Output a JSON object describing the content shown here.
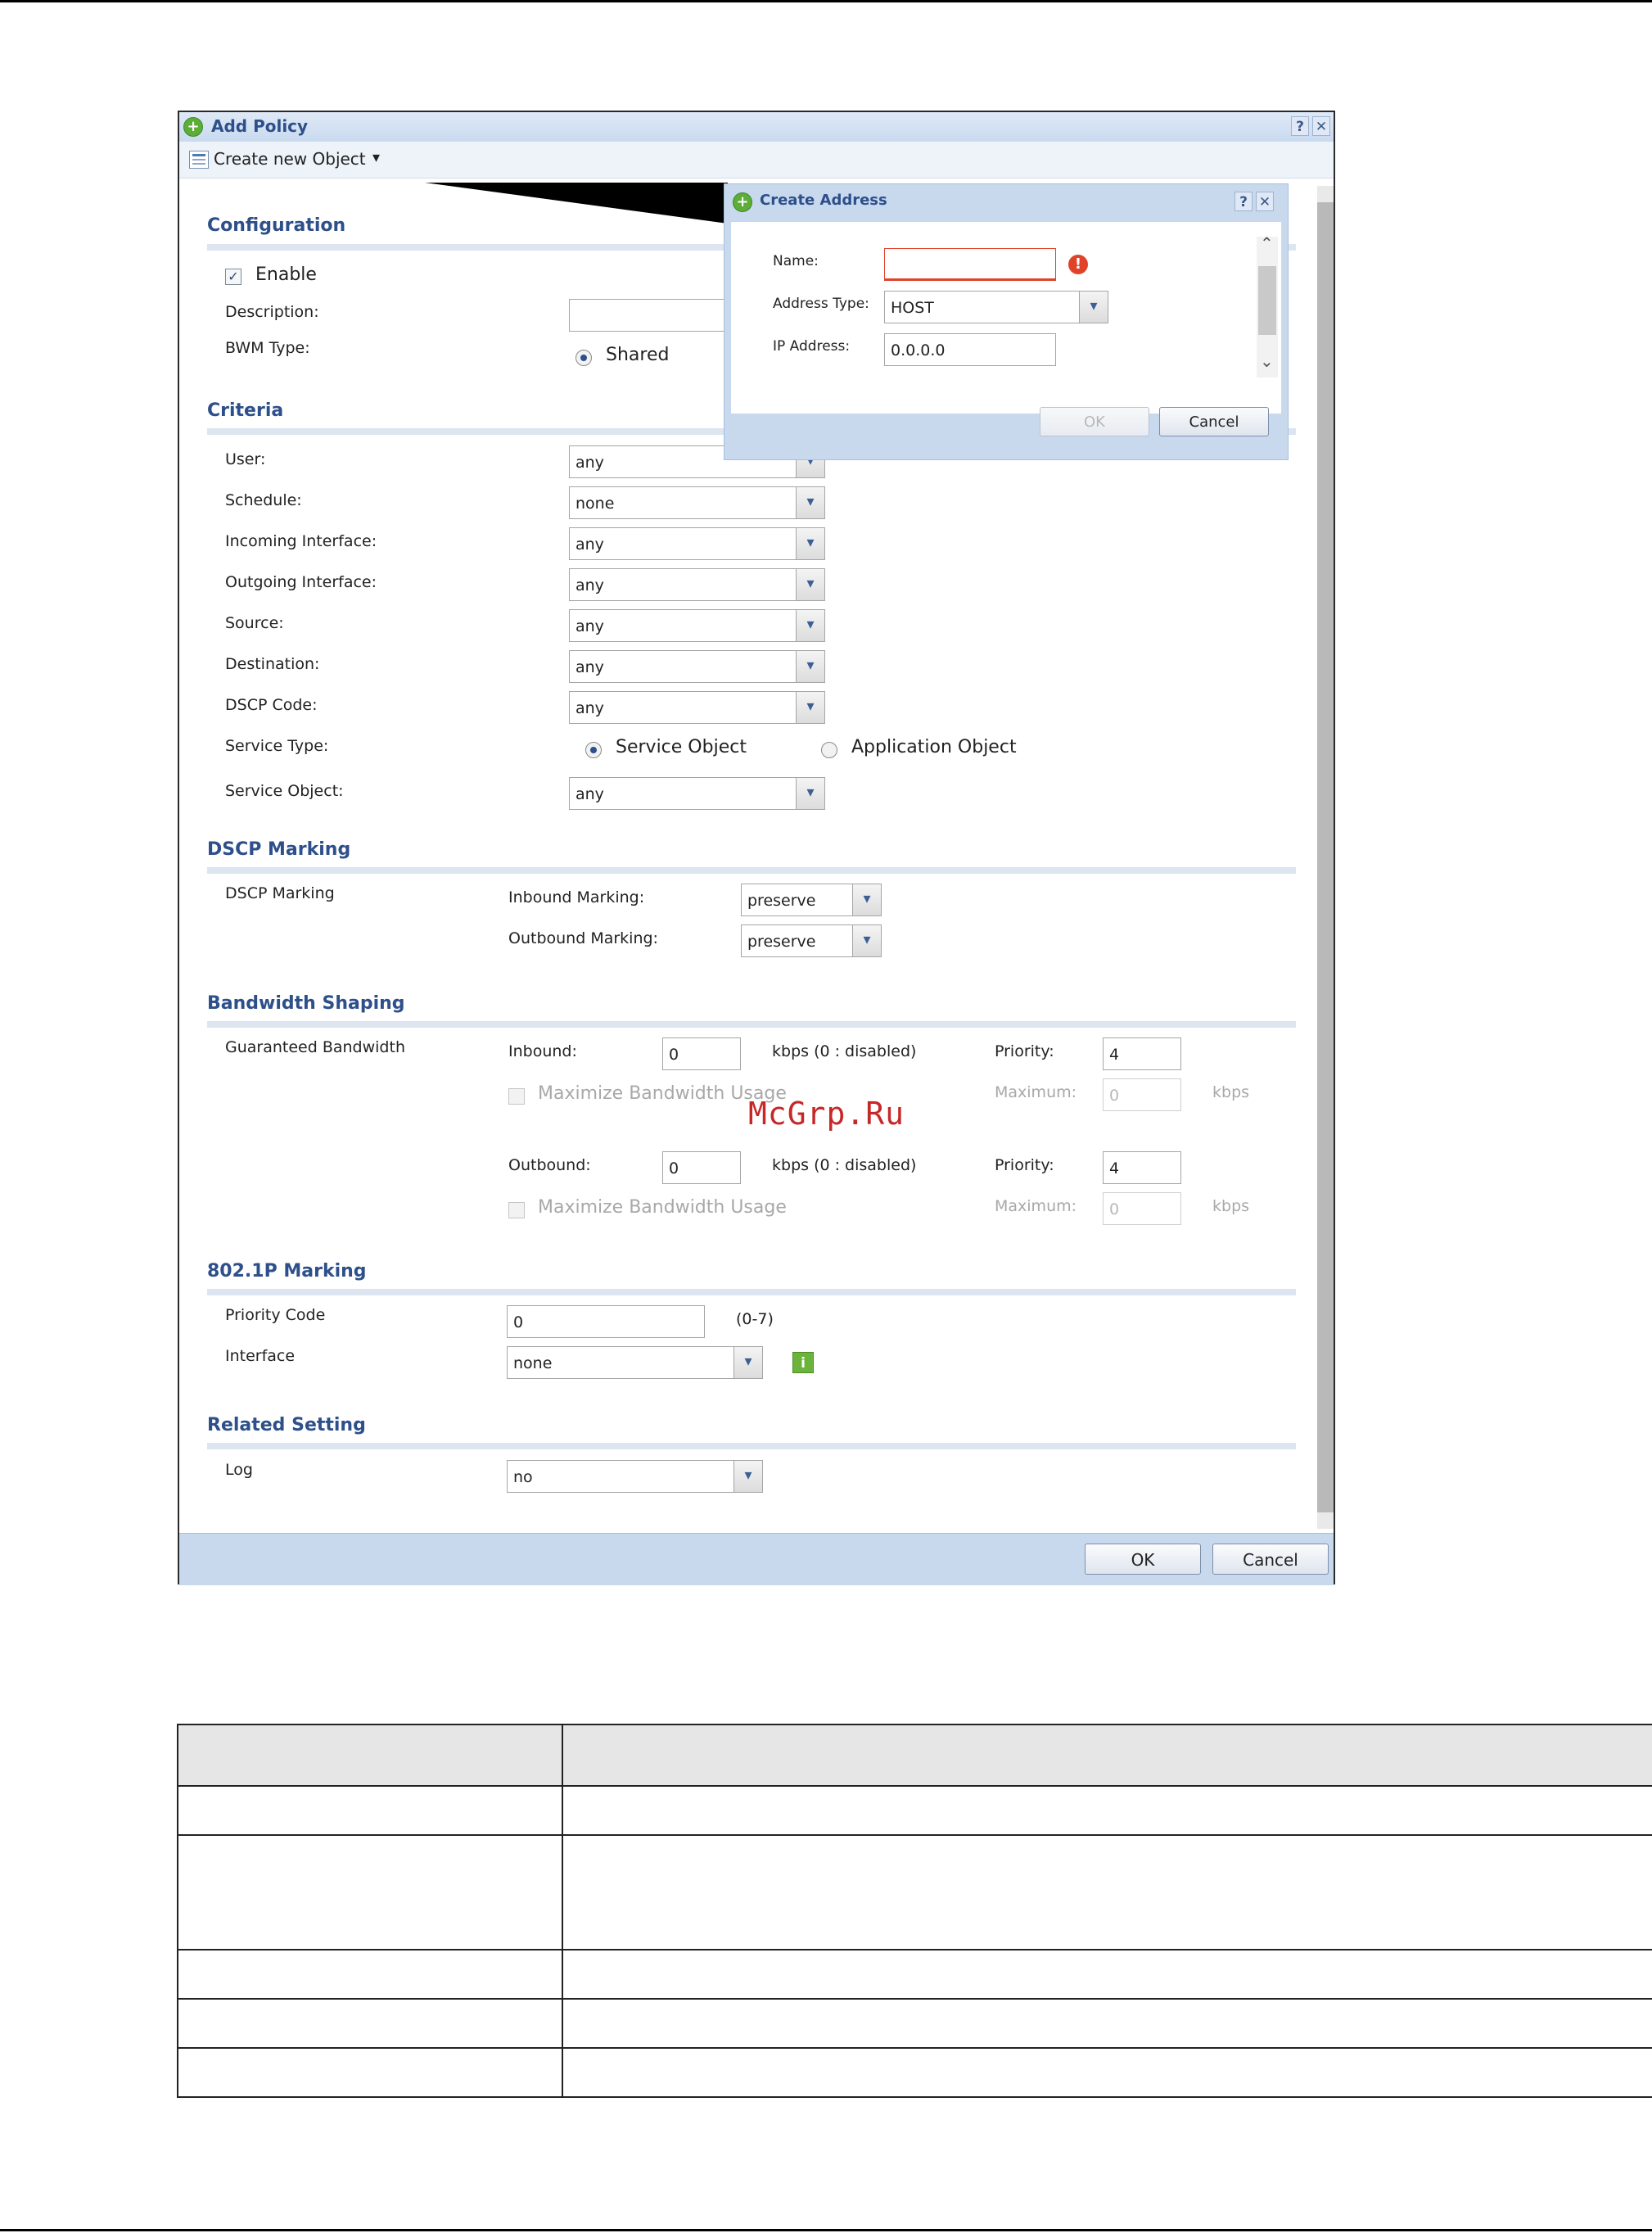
{
  "dialog": {
    "title": "Add Policy",
    "help": "?",
    "close": "✕",
    "toolbar_label": "Create new Object",
    "toolbar_arrow": "▾",
    "ok": "OK",
    "cancel": "Cancel"
  },
  "configuration": {
    "heading": "Configuration",
    "enable_label": "Enable",
    "enable_checked": true,
    "description_label": "Description:",
    "description_value": "",
    "bwm_label": "BWM Type:",
    "bwm_value": "Shared"
  },
  "criteria": {
    "heading": "Criteria",
    "rows": [
      {
        "label": "User:",
        "value": "any"
      },
      {
        "label": "Schedule:",
        "value": "none"
      },
      {
        "label": "Incoming Interface:",
        "value": "any"
      },
      {
        "label": "Outgoing Interface:",
        "value": "any"
      },
      {
        "label": "Source:",
        "value": "any"
      },
      {
        "label": "Destination:",
        "value": "any"
      },
      {
        "label": "DSCP Code:",
        "value": "any"
      }
    ],
    "service_type_label": "Service Type:",
    "service_type_options": [
      "Service Object",
      "Application Object"
    ],
    "service_type_selected": "Service Object",
    "service_object_label": "Service Object:",
    "service_object_value": "any"
  },
  "dscp": {
    "heading": "DSCP Marking",
    "row_label": "DSCP Marking",
    "inbound_label": "Inbound Marking:",
    "inbound_value": "preserve",
    "outbound_label": "Outbound Marking:",
    "outbound_value": "preserve"
  },
  "bandwidth": {
    "heading": "Bandwidth Shaping",
    "row_label": "Guaranteed Bandwidth",
    "inbound_label": "Inbound:",
    "inbound_value": "0",
    "outbound_label": "Outbound:",
    "outbound_value": "0",
    "unit_note": "kbps (0 : disabled)",
    "priority_label": "Priority:",
    "inbound_priority": "4",
    "outbound_priority": "4",
    "maximize_label": "Maximize Bandwidth Usage",
    "maximum_label": "Maximum:",
    "maximum_value": "0",
    "kbps": "kbps"
  },
  "p8021": {
    "heading": "802.1P Marking",
    "priority_label": "Priority Code",
    "priority_value": "0",
    "priority_range": "(0-7)",
    "interface_label": "Interface",
    "interface_value": "none",
    "info_icon": "i"
  },
  "related": {
    "heading": "Related Setting",
    "log_label": "Log",
    "log_value": "no"
  },
  "popup": {
    "title": "Create Address",
    "help": "?",
    "close": "✕",
    "name_label": "Name:",
    "name_value": "",
    "address_type_label": "Address Type:",
    "address_type_value": "HOST",
    "ip_label": "IP Address:",
    "ip_value": "0.0.0.0",
    "error_icon": "!",
    "ok": "OK",
    "cancel": "Cancel"
  },
  "watermark": "McGrp.Ru",
  "colors": {
    "heading_blue": "#2d4f8a",
    "title_bar": "#c9daf0",
    "footer": "#c8d9ee",
    "error_red": "#e0432a",
    "plus_green": "#5cae38",
    "watermark_red": "#c62828"
  }
}
